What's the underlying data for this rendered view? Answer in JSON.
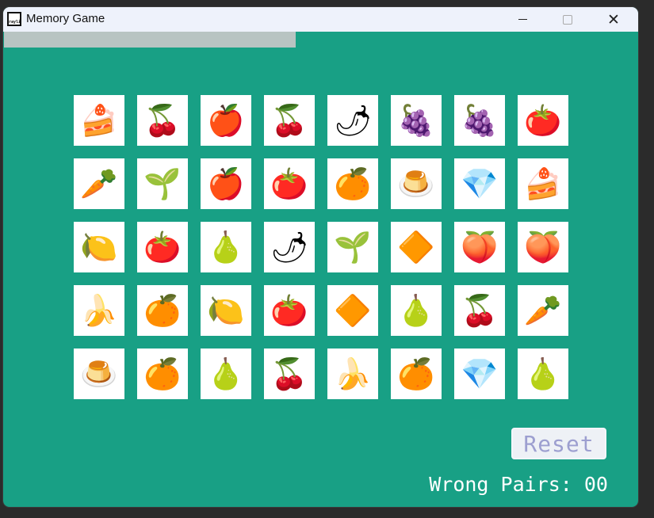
{
  "window": {
    "title": "Memory Game",
    "icon_label": "raylib",
    "minimize_glyph": "",
    "close_glyph": "✕"
  },
  "progress_bar": {
    "fraction": 0.46
  },
  "cards": [
    {
      "item": "cake",
      "icon": "🍰"
    },
    {
      "item": "plum",
      "icon": "🍒"
    },
    {
      "item": "apple-half",
      "icon": "🍎"
    },
    {
      "item": "cherries",
      "icon": "🍒"
    },
    {
      "item": "chili-pepper",
      "icon": "🌶"
    },
    {
      "item": "grapes",
      "icon": "🍇"
    },
    {
      "item": "grapes",
      "icon": "🍇"
    },
    {
      "item": "tomato-half",
      "icon": "🍅"
    },
    {
      "item": "carrot",
      "icon": "🥕"
    },
    {
      "item": "radish",
      "icon": "🌱"
    },
    {
      "item": "apple-half",
      "icon": "🍎"
    },
    {
      "item": "tomato",
      "icon": "🍅"
    },
    {
      "item": "orange",
      "icon": "🍊"
    },
    {
      "item": "jelly",
      "icon": "🍮"
    },
    {
      "item": "purple-gem",
      "icon": "💎"
    },
    {
      "item": "cake",
      "icon": "🍰"
    },
    {
      "item": "lemon",
      "icon": "🍋"
    },
    {
      "item": "tomato-half",
      "icon": "🍅"
    },
    {
      "item": "pear",
      "icon": "🍐"
    },
    {
      "item": "chili-pepper",
      "icon": "🌶"
    },
    {
      "item": "radish",
      "icon": "🌱"
    },
    {
      "item": "orange-gem",
      "icon": "🔶"
    },
    {
      "item": "peach-half",
      "icon": "🍑"
    },
    {
      "item": "peach-half",
      "icon": "🍑"
    },
    {
      "item": "banana",
      "icon": "🍌"
    },
    {
      "item": "orange-slice",
      "icon": "🍊"
    },
    {
      "item": "lemon",
      "icon": "🍋"
    },
    {
      "item": "tomato",
      "icon": "🍅"
    },
    {
      "item": "orange-gem",
      "icon": "🔶"
    },
    {
      "item": "pear",
      "icon": "🍐"
    },
    {
      "item": "plum",
      "icon": "🍒"
    },
    {
      "item": "carrot",
      "icon": "🥕"
    },
    {
      "item": "jelly",
      "icon": "🍮"
    },
    {
      "item": "orange",
      "icon": "🍊"
    },
    {
      "item": "pear-half",
      "icon": "🍐"
    },
    {
      "item": "cherries",
      "icon": "🍒"
    },
    {
      "item": "banana",
      "icon": "🍌"
    },
    {
      "item": "orange-slice",
      "icon": "🍊"
    },
    {
      "item": "purple-gem",
      "icon": "💎"
    },
    {
      "item": "pear-half",
      "icon": "🍐"
    }
  ],
  "reset_label": "Reset",
  "status": {
    "wrong_pairs_text": "Wrong Pairs: 00"
  },
  "colors": {
    "background": "#18a085",
    "card": "#ffffff",
    "titlebar": "#eef2fb",
    "progress": "#b8c4c2",
    "reset_text": "#9d9fd0"
  }
}
